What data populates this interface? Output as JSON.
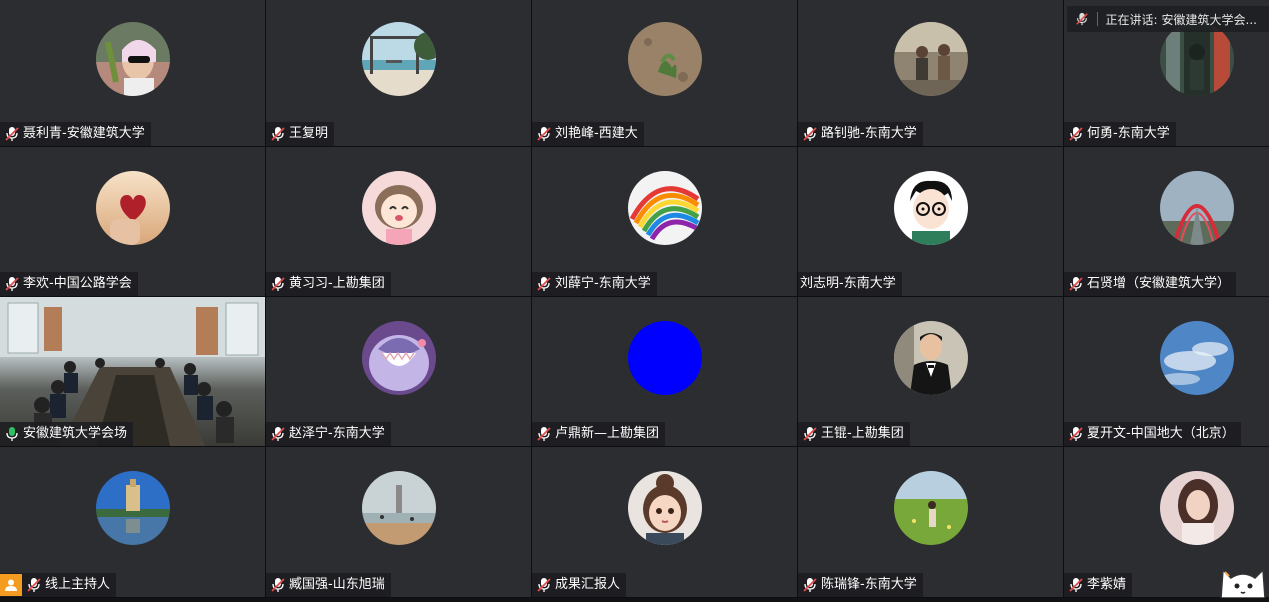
{
  "speaking": {
    "prefix": "正在讲话:",
    "name": "安徽建筑大学会..."
  },
  "participants": [
    {
      "name": "聂利青-安徽建筑大学",
      "avatar": "selfie-avatar",
      "muted": true
    },
    {
      "name": "王复明",
      "avatar": "beach-swing-avatar",
      "muted": true
    },
    {
      "name": "刘艳峰-西建大",
      "avatar": "plant-ground-avatar",
      "muted": true
    },
    {
      "name": "路钊驰-东南大学",
      "avatar": "street-musicians-avatar",
      "muted": true
    },
    {
      "name": "何勇-东南大学",
      "avatar": "city-person-avatar",
      "muted": true
    },
    {
      "name": "李欢-中国公路学会",
      "avatar": "heart-sunset-avatar",
      "muted": true
    },
    {
      "name": "黄习习-上勘集团",
      "avatar": "cartoon-girl-avatar",
      "muted": true
    },
    {
      "name": "刘薛宁-东南大学",
      "avatar": "rainbow-drawing-avatar",
      "muted": true
    },
    {
      "name": "刘志明-东南大学",
      "avatar": "cartoon-glasses-boy-avatar",
      "muted": false
    },
    {
      "name": "石贤增（安徽建筑大学）",
      "avatar": "red-arch-bridge-avatar",
      "muted": true
    },
    {
      "name": "安徽建筑大学会场",
      "avatar": "meeting-room-video",
      "muted": false,
      "active": true
    },
    {
      "name": "赵泽宁-东南大学",
      "avatar": "shark-cartoon-avatar",
      "muted": true
    },
    {
      "name": "卢鼎新—上勘集团",
      "avatar": "blue-circle-avatar",
      "muted": true
    },
    {
      "name": "王锟-上勘集团",
      "avatar": "man-in-suit-avatar",
      "muted": true
    },
    {
      "name": "夏开文-中国地大（北京）",
      "avatar": "blue-sky-avatar",
      "muted": true
    },
    {
      "name": "线上主持人",
      "avatar": "lakeside-tower-avatar",
      "muted": true,
      "host": true
    },
    {
      "name": "臧国强-山东旭瑞",
      "avatar": "beach-tower-avatar",
      "muted": true
    },
    {
      "name": "成果汇报人",
      "avatar": "cartoon-girl-hairbun-avatar",
      "muted": true
    },
    {
      "name": "陈瑞锋-东南大学",
      "avatar": "meadow-person-avatar",
      "muted": true
    },
    {
      "name": "李紫婧",
      "avatar": "portrait-girl-avatar",
      "muted": true
    }
  ],
  "colors": {
    "tile": "#2b2d31",
    "label_bg": "#1c1d20",
    "active_border": "#2fbf60",
    "muted_red": "#e24b4b",
    "host_orange": "#f39c1f",
    "blue_avatar": "#0000ff"
  }
}
